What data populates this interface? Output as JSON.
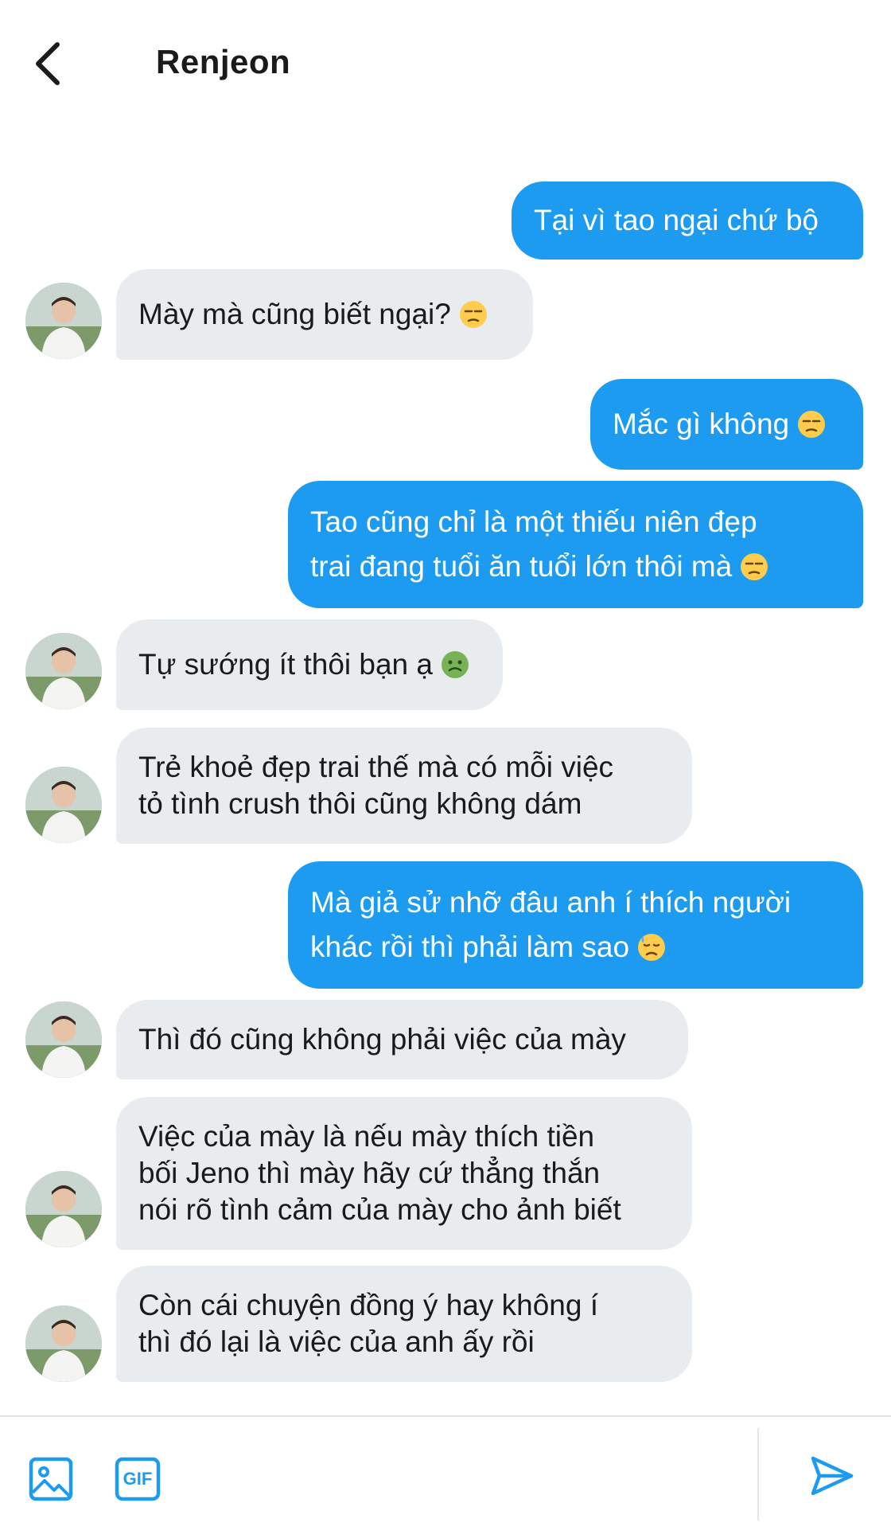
{
  "header": {
    "title": "Renjeon"
  },
  "messages": [
    {
      "from": "me",
      "text": "Tại vì tao ngại chứ bộ",
      "emoji": ""
    },
    {
      "from": "them",
      "text": "Mày mà cũng biết ngại?",
      "emoji": "unamused-face"
    },
    {
      "from": "me",
      "text": "Mắc gì không",
      "emoji": "unamused-face"
    },
    {
      "from": "me",
      "lines": [
        "Tao cũng chỉ là một thiếu niên đẹp",
        "trai đang tuổi ăn tuổi lớn thôi mà"
      ],
      "emoji": "unamused-face"
    },
    {
      "from": "them",
      "text": "Tự sướng ít thôi bạn ạ",
      "emoji": "nauseated-face"
    },
    {
      "from": "them",
      "lines": [
        "Trẻ khoẻ đẹp trai thế mà có mỗi việc",
        "tỏ tình crush thôi cũng không dám"
      ]
    },
    {
      "from": "me",
      "lines": [
        "Mà giả sử nhỡ đâu anh í thích người",
        "khác rồi thì phải làm sao"
      ],
      "emoji": "downcast-sweat-face"
    },
    {
      "from": "them",
      "text": "Thì đó cũng không phải việc của mày"
    },
    {
      "from": "them",
      "lines": [
        "Việc của mày là nếu mày thích tiền",
        "bối Jeno thì mày hãy cứ thẳng thắn",
        "nói rõ tình cảm của mày cho ảnh biết"
      ]
    },
    {
      "from": "them",
      "lines": [
        "Còn cái chuyện đồng ý hay không í",
        "thì đó lại là việc của anh ấy rồi"
      ]
    }
  ],
  "composer": {
    "image_icon": "image-icon",
    "gif_label": "GIF",
    "send_icon": "send-icon"
  },
  "colors": {
    "sent": "#1d9bf0",
    "received": "#e8ecef",
    "accent": "#1d9bf0"
  }
}
